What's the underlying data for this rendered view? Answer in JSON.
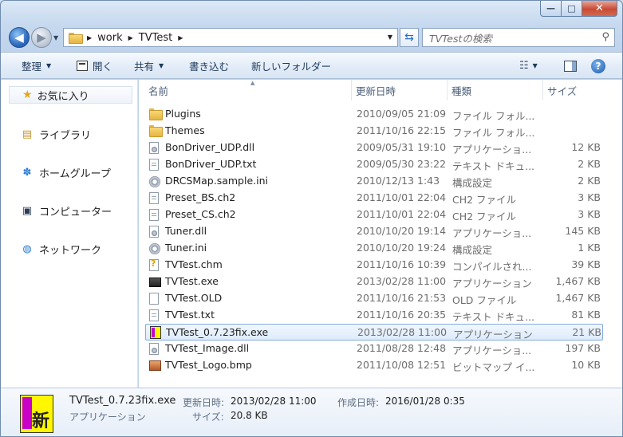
{
  "window": {
    "min_glyph": "—",
    "max_glyph": "□",
    "close_glyph": "✕"
  },
  "address": {
    "crumbs": [
      "work",
      "TVTest"
    ]
  },
  "search": {
    "placeholder": "TVTestの検索"
  },
  "toolbar": {
    "organize": "整理",
    "open": "開く",
    "share": "共有",
    "burn": "書き込む",
    "new_folder": "新しいフォルダー"
  },
  "sidebar": {
    "favorites": "お気に入り",
    "libraries": "ライブラリ",
    "homegroup": "ホームグループ",
    "computer": "コンピューター",
    "network": "ネットワーク"
  },
  "columns": {
    "name": "名前",
    "date": "更新日時",
    "type": "種類",
    "size": "サイズ"
  },
  "files": [
    {
      "name": "Plugins",
      "date": "2010/09/05 21:09",
      "type": "ファイル フォル...",
      "size": "",
      "icon": "folder-icon"
    },
    {
      "name": "Themes",
      "date": "2011/10/16 22:15",
      "type": "ファイル フォル...",
      "size": "",
      "icon": "folder-icon"
    },
    {
      "name": "BonDriver_UDP.dll",
      "date": "2009/05/31 19:10",
      "type": "アプリケーショ...",
      "size": "12 KB",
      "icon": "dll-icon"
    },
    {
      "name": "BonDriver_UDP.txt",
      "date": "2009/05/30 23:22",
      "type": "テキスト ドキュ...",
      "size": "2 KB",
      "icon": "text-file-icon"
    },
    {
      "name": "DRCSMap.sample.ini",
      "date": "2010/12/13 1:43",
      "type": "構成設定",
      "size": "2 KB",
      "icon": "settings-file-icon"
    },
    {
      "name": "Preset_BS.ch2",
      "date": "2011/10/01 22:04",
      "type": "CH2 ファイル",
      "size": "3 KB",
      "icon": "text-file-icon"
    },
    {
      "name": "Preset_CS.ch2",
      "date": "2011/10/01 22:04",
      "type": "CH2 ファイル",
      "size": "3 KB",
      "icon": "text-file-icon"
    },
    {
      "name": "Tuner.dll",
      "date": "2010/10/20 19:14",
      "type": "アプリケーショ...",
      "size": "145 KB",
      "icon": "dll-icon"
    },
    {
      "name": "Tuner.ini",
      "date": "2010/10/20 19:24",
      "type": "構成設定",
      "size": "1 KB",
      "icon": "settings-file-icon"
    },
    {
      "name": "TVTest.chm",
      "date": "2011/10/16 10:39",
      "type": "コンパイルされ...",
      "size": "39 KB",
      "icon": "help-file-icon"
    },
    {
      "name": "TVTest.exe",
      "date": "2013/02/28 11:00",
      "type": "アプリケーション",
      "size": "1,467 KB",
      "icon": "exe-icon"
    },
    {
      "name": "TVTest.OLD",
      "date": "2011/10/16 21:53",
      "type": "OLD ファイル",
      "size": "1,467 KB",
      "icon": "blank-file-icon"
    },
    {
      "name": "TVTest.txt",
      "date": "2011/10/16 20:35",
      "type": "テキスト ドキュ...",
      "size": "81 KB",
      "icon": "text-file-icon"
    },
    {
      "name": "TVTest_0.7.23fix.exe",
      "date": "2013/02/28 11:00",
      "type": "アプリケーション",
      "size": "21 KB",
      "icon": "shin-app-icon",
      "selected": true
    },
    {
      "name": "TVTest_Image.dll",
      "date": "2011/08/28 12:48",
      "type": "アプリケーショ...",
      "size": "197 KB",
      "icon": "dll-icon"
    },
    {
      "name": "TVTest_Logo.bmp",
      "date": "2011/10/08 12:51",
      "type": "ビットマップ イ...",
      "size": "10 KB",
      "icon": "bitmap-icon"
    }
  ],
  "details": {
    "filename": "TVTest_0.7.23fix.exe",
    "filetype": "アプリケーション",
    "modified_label": "更新日時:",
    "modified_value": "2013/02/28 11:00",
    "created_label": "作成日時:",
    "created_value": "2016/01/28 0:35",
    "size_label": "サイズ:",
    "size_value": "20.8 KB",
    "icon_glyph": "新"
  }
}
